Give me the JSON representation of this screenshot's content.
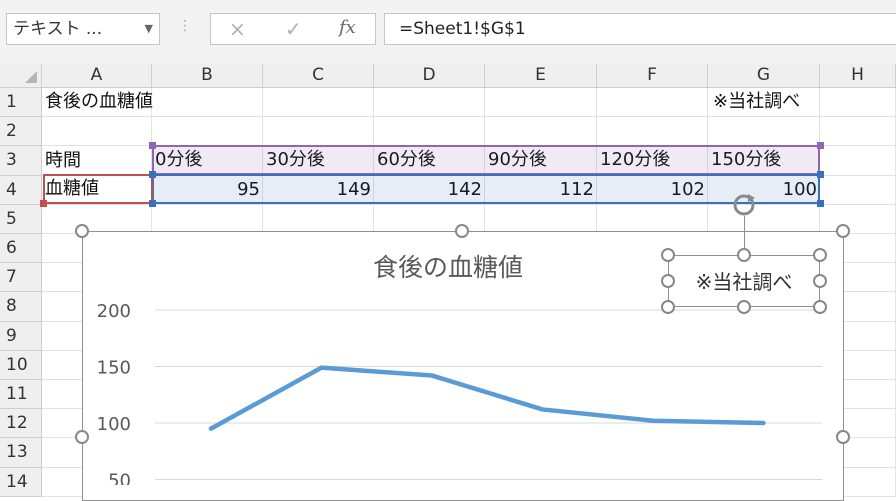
{
  "formula_bar": {
    "name_box": "テキスト ...",
    "cancel_icon": "×",
    "enter_icon": "✓",
    "fx_icon": "fx",
    "formula": "=Sheet1!$G$1"
  },
  "columns": [
    "A",
    "B",
    "C",
    "D",
    "E",
    "F",
    "G",
    "H"
  ],
  "rows": [
    "1",
    "2",
    "3",
    "4",
    "5",
    "6",
    "7",
    "8",
    "9",
    "10",
    "11",
    "12",
    "13",
    "14"
  ],
  "sheet": {
    "a1": "食後の血糖値",
    "g1": "※当社調べ",
    "a3": "時間",
    "a4": "血糖値",
    "times": [
      "0分後",
      "30分後",
      "60分後",
      "90分後",
      "120分後",
      "150分後"
    ],
    "values": [
      "95",
      "149",
      "142",
      "112",
      "102",
      "100"
    ]
  },
  "chart": {
    "title": "食後の血糖値",
    "textbox": "※当社調べ",
    "y_ticks": [
      "200",
      "150",
      "100",
      "50"
    ]
  },
  "chart_data": {
    "type": "line",
    "title": "食後の血糖値",
    "categories": [
      "0分後",
      "30分後",
      "60分後",
      "90分後",
      "120分後",
      "150分後"
    ],
    "series": [
      {
        "values": [
          95,
          149,
          142,
          112,
          102,
          100
        ]
      }
    ],
    "ylim": [
      0,
      200
    ],
    "y_ticks": [
      50,
      100,
      150,
      200
    ],
    "color": "#5b9bd5",
    "grid": true
  },
  "colors": {
    "line": "#5b9bd5",
    "range_purple": "#8e67b0",
    "range_blue": "#3a6fc0",
    "range_red": "#c0504d"
  }
}
